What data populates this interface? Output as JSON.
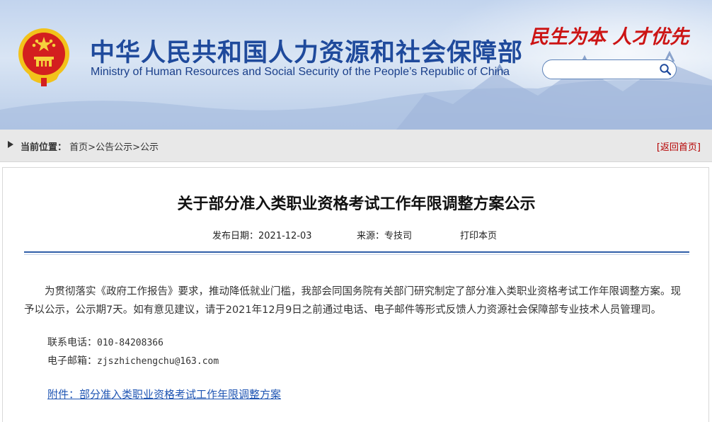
{
  "header": {
    "title_cn": "中华人民共和国人力资源和社会保障部",
    "title_en": "Ministry of Human Resources and Social Security of the People’s Republic of China",
    "slogan": "民生为本 人才优先",
    "search": {
      "value": "",
      "placeholder": ""
    }
  },
  "breadcrumb": {
    "label": "当前位置：",
    "items": [
      "首页",
      "公告公示",
      "公示"
    ],
    "separator": ">",
    "back_home": "[返回首页]"
  },
  "article": {
    "title": "关于部分准入类职业资格考试工作年限调整方案公示",
    "publish_date_label": "发布日期：",
    "publish_date": "2021-12-03",
    "source_label": "来源：",
    "source": "专技司",
    "print_label": "打印本页",
    "paragraph": "为贯彻落实《政府工作报告》要求，推动降低就业门槛，我部会同国务院有关部门研究制定了部分准入类职业资格考试工作年限调整方案。现予以公示，公示期7天。如有意见建议，请于2021年12月9日之前通过电话、电子邮件等形式反馈人力资源社会保障部专业技术人员管理司。",
    "phone_label": "联系电话：",
    "phone": "010-84208366",
    "email_label": "电子邮箱：",
    "email": "zjszhichengchu@163.com",
    "attachment": "附件：部分准入类职业资格考试工作年限调整方案"
  },
  "colors": {
    "title_blue": "#1f4a9c",
    "slogan_red": "#cc1414",
    "link_blue": "#1f55b3",
    "back_red": "#b50000",
    "divider_blue": "#2f5ea8"
  },
  "icons": [
    "national-emblem-icon",
    "search-icon",
    "breadcrumb-arrow-icon"
  ]
}
